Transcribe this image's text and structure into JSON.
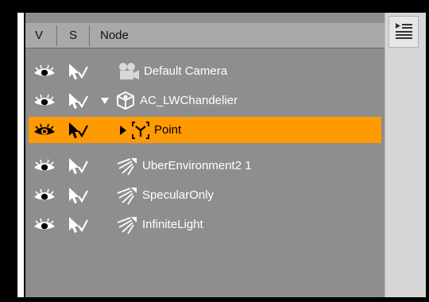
{
  "columns": {
    "visible": "V",
    "selectable": "S",
    "node": "Node"
  },
  "rows": [
    {
      "label": "Default Camera",
      "node_icon": "camera-icon",
      "expander": "none",
      "selected": false
    },
    {
      "label": "AC_LWChandelier",
      "node_icon": "prop-icon",
      "expander": "expanded",
      "selected": false
    },
    {
      "label": "Point",
      "node_icon": "null-node-icon",
      "expander": "collapsed",
      "selected": true
    },
    {
      "label": "UberEnvironment2 1",
      "node_icon": "light-icon",
      "expander": "none",
      "selected": false
    },
    {
      "label": "SpecularOnly",
      "node_icon": "light-icon",
      "expander": "none",
      "selected": false
    },
    {
      "label": "InfiniteLight",
      "node_icon": "light-icon",
      "expander": "none",
      "selected": false
    }
  ],
  "colors": {
    "panel": "#8e8e8e",
    "header": "#a9a9a9",
    "selection": "#ff9a00",
    "text": "#ffffff"
  },
  "menu_icon": "list-menu-icon"
}
